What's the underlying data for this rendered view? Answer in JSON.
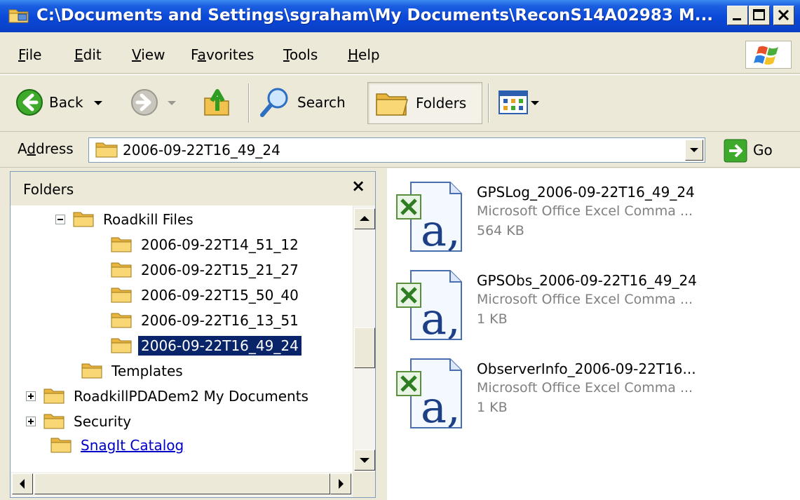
{
  "window": {
    "title": "C:\\Documents and Settings\\sgraham\\My Documents\\ReconS14A02983 M..."
  },
  "menu": [
    {
      "pre": "",
      "u": "F",
      "post": "ile"
    },
    {
      "pre": "",
      "u": "E",
      "post": "dit"
    },
    {
      "pre": "",
      "u": "V",
      "post": "iew"
    },
    {
      "pre": "F",
      "u": "a",
      "post": "vorites"
    },
    {
      "pre": "",
      "u": "T",
      "post": "ools"
    },
    {
      "pre": "",
      "u": "H",
      "post": "elp"
    }
  ],
  "toolbar": {
    "back_label": "Back",
    "search_label": "Search",
    "folders_label": "Folders"
  },
  "address": {
    "label_pre": "A",
    "label_u": "d",
    "label_post": "dress",
    "value": "2006-09-22T16_49_24",
    "go_label": "Go"
  },
  "folders_pane": {
    "title": "Folders",
    "close": "×",
    "tree": [
      {
        "label": "Roadkill Files",
        "expander": "minus",
        "selected": false,
        "link": false
      },
      {
        "label": "2006-09-22T14_51_12",
        "expander": "none",
        "selected": false,
        "link": false
      },
      {
        "label": "2006-09-22T15_21_27",
        "expander": "none",
        "selected": false,
        "link": false
      },
      {
        "label": "2006-09-22T15_50_40",
        "expander": "none",
        "selected": false,
        "link": false
      },
      {
        "label": "2006-09-22T16_13_51",
        "expander": "none",
        "selected": false,
        "link": false
      },
      {
        "label": "2006-09-22T16_49_24",
        "expander": "none",
        "selected": true,
        "link": false
      },
      {
        "label": "Templates",
        "expander": "none",
        "selected": false,
        "link": false
      },
      {
        "label": "RoadkillPDADem2 My Documents",
        "expander": "plus",
        "selected": false,
        "link": false
      },
      {
        "label": "Security",
        "expander": "plus",
        "selected": false,
        "link": false
      },
      {
        "label": "SnagIt Catalog",
        "expander": "none",
        "selected": false,
        "link": true
      }
    ]
  },
  "files": [
    {
      "name": "GPSLog_2006-09-22T16_49_24",
      "type": "Microsoft Office Excel Comma ...",
      "size": "564 KB"
    },
    {
      "name": "GPSObs_2006-09-22T16_49_24",
      "type": "Microsoft Office Excel Comma ...",
      "size": "1 KB"
    },
    {
      "name": "ObserverInfo_2006-09-22T16...",
      "type": "Microsoft Office Excel Comma ...",
      "size": "1 KB"
    }
  ],
  "colors": {
    "titlebar": "#0a48d8",
    "selection": "#0a246a",
    "link": "#0000c8",
    "chrome": "#ece9d8"
  }
}
